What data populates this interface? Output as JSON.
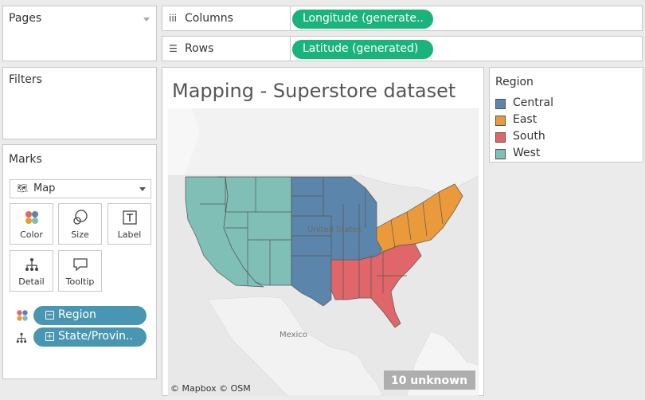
{
  "pages": {
    "title": "Pages"
  },
  "filters": {
    "title": "Filters"
  },
  "marks": {
    "title": "Marks",
    "mark_type": "Map",
    "buttons": {
      "color": "Color",
      "size": "Size",
      "label": "Label",
      "detail": "Detail",
      "tooltip": "Tooltip"
    },
    "fields": [
      {
        "label": "Region",
        "encoding": "color",
        "toggle": "minus"
      },
      {
        "label": "State/Provin..",
        "encoding": "detail",
        "toggle": "plus"
      }
    ]
  },
  "shelves": {
    "columns": {
      "label": "Columns",
      "pill": "Longitude (generate.."
    },
    "rows": {
      "label": "Rows",
      "pill": "Latitude (generated)"
    }
  },
  "viz": {
    "title": "Mapping - Superstore dataset",
    "map_labels": {
      "country_usa": "United States",
      "mexico": "Mexico"
    },
    "attribution": "© Mapbox © OSM",
    "unknown_badge": "10 unknown"
  },
  "legend": {
    "title": "Region",
    "items": [
      {
        "label": "Central",
        "color": "#5b85aa"
      },
      {
        "label": "East",
        "color": "#eb9a3b"
      },
      {
        "label": "South",
        "color": "#e06669"
      },
      {
        "label": "West",
        "color": "#7fbfb5"
      }
    ]
  },
  "colors": {
    "central": "#5b85aa",
    "east": "#eb9a3b",
    "south": "#e06669",
    "west": "#7fbfb5",
    "pill_green": "#19b37c",
    "pill_blue": "#4996b2"
  }
}
